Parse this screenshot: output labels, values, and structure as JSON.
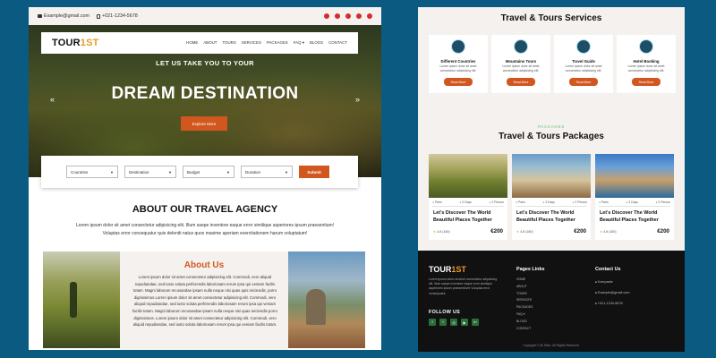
{
  "left": {
    "topbar": {
      "email": "Example@gmail.com",
      "phone": "+021-1234-5678"
    },
    "logo": {
      "main": "TOUR",
      "accent": "1ST"
    },
    "menu": [
      "HOME",
      "ABOUT",
      "TOURS",
      "SERVICES",
      "PACKAGES",
      "FAQ ▾",
      "BLOGS",
      "CONTACT"
    ],
    "hero": {
      "subtitle": "LET US TAKE YOU TO YOUR",
      "title": "DREAM DESTINATION",
      "button": "Explore More",
      "prev": "«",
      "next": "»"
    },
    "search": {
      "fields": [
        "Countries",
        "Destination",
        "Budget",
        "Duration"
      ],
      "submit": "Submit"
    },
    "about": {
      "title": "ABOUT OUR TRAVEL AGENCY",
      "desc": "Lorem ipsum dolor sit amet consectetur adipisicing elit. Illum saepe inventore eaque error similique asperiores ipsum praesentium! Voluptas error consequatur quis deleniti natus quos maxime aperiam exercitationem harum voluptatum!",
      "heading": "About Us",
      "body": "Lorem ipsum dolor sit amet consectetur adipisicing elit. Commodi, vero aliquid repudiandae, sed iusto soluta perferendis laboriosam rerum ipsa qui veniam facilis totam. Magni laborum recusandae ipsam nulla neque nisi quas quis reiciendis, porro dignissimos Lorem ipsum dolor sit amet consectetur adipisicing elit. Commodi, vero aliquid repudiandae, sed iusto soluta perferendis laboriosam rerum ipsa qui veniam facilis totam. Magni laborum recusandae ipsam nulla neque nisi quas reiciendis porro dignissimos. Lorem ipsum dolor sit amet consectetur adipisicing elit. Commodi, vero aliquid repudiandae, sed iusto soluta laboriosam rerum ipsa qui veniam facilis totam."
    }
  },
  "right": {
    "services_title": "Travel & Tours Services",
    "services": [
      {
        "name": "Different Countries",
        "desc": "Lorem ipsum dolor sit amet consectetur adipisicing elit.",
        "button": "Read More"
      },
      {
        "name": "Mountains Tours",
        "desc": "Lorem ipsum dolor sit amet consectetur adipisicing elit.",
        "button": "Read More"
      },
      {
        "name": "Travel Guide",
        "desc": "Lorem ipsum dolor sit amet consectetur adipisicing elit.",
        "button": "Read More"
      },
      {
        "name": "Hotel Booking",
        "desc": "Lorem ipsum dolor sit amet consectetur adipisicing elit.",
        "button": "Read More"
      }
    ],
    "packages_kicker": "PACKAGES",
    "packages_title": "Travel & Tours Packages",
    "packages": [
      {
        "place": "Paris",
        "days": "3 Days",
        "persons": "2 Person",
        "title": "Let's Discover The World Beautiful Places Together",
        "rating": "4.8 (180)",
        "price": "€200"
      },
      {
        "place": "Paris",
        "days": "3 Days",
        "persons": "2 Person",
        "title": "Let's Discover The World Beautiful Places Together",
        "rating": "4.8 (180)",
        "price": "€200"
      },
      {
        "place": "Paris",
        "days": "3 Days",
        "persons": "2 Person",
        "title": "Let's Discover The World Beautiful Places Together",
        "rating": "4.8 (180)",
        "price": "€200"
      }
    ],
    "footer": {
      "logo": {
        "main": "TOUR",
        "accent": "1ST"
      },
      "desc": "Lorem ipsum dolor sit amet consectetur adipisicing elit. Illum saepe inventore eaque error similique asperiores ipsum praesentium! Voluptas error consequatur.",
      "follow": "FOLLOW US",
      "social_icons": [
        "facebook-icon",
        "twitter-icon",
        "instagram-icon",
        "youtube-icon",
        "linkedin-icon"
      ],
      "pages_title": "Pages Links",
      "pages": [
        "HOME",
        "ABOUT",
        "TOURS",
        "SERVICES",
        "PACKAGES",
        "FAQ ▾",
        "BLOGS",
        "CONTACT"
      ],
      "contact_title": "Contact Us",
      "contact": [
        "Kompaste",
        "Example@gmail.com",
        "+021-1234-5678"
      ],
      "copyright": "Copyright © All Sites. All Rights Reserved."
    }
  },
  "colors": {
    "accent": "#d2571f",
    "brand_yellow": "#e79c2a",
    "green": "#62c26a",
    "background": "#0a5a82",
    "footer": "#111111"
  }
}
